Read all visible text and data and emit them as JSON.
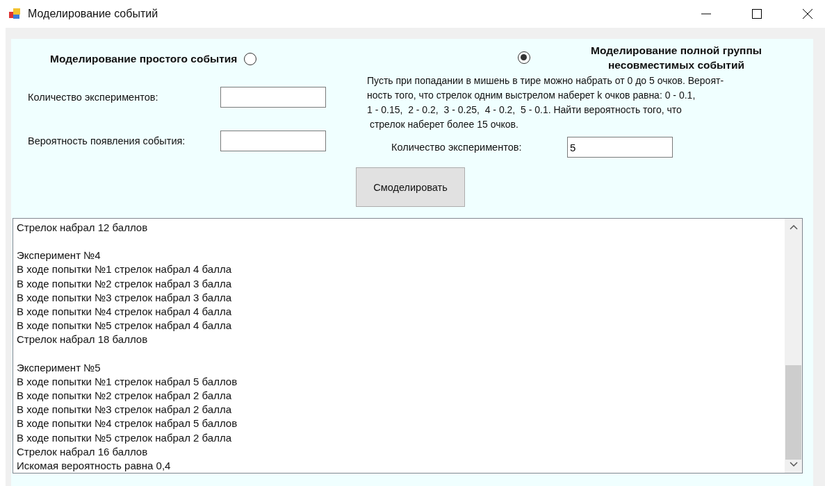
{
  "window": {
    "title": "Моделирование событий"
  },
  "modes": [
    {
      "label": "Моделирование простого события",
      "selected": false
    },
    {
      "label": "Моделирование полной группы несовместимых событий",
      "selected": true
    }
  ],
  "simple": {
    "fields": [
      {
        "label": "Количество экспериментов:"
      },
      {
        "label": "Вероятность появления события:"
      }
    ]
  },
  "group": {
    "problem": "Пусть при попадании в мишень в тире можно набрать от 0 до 5 очков. Вероят-\nность того, что стрелок одним выстрелом наберет k очков равна: 0 - 0.1,\n1 - 0.15,  2 - 0.2,  3 - 0.25,  4 - 0.2,  5 - 0.1. Найти вероятность того, что\n стрелок наберет более 15 очков.",
    "field": {
      "label": "Количество экспериментов:",
      "value": "5"
    }
  },
  "button": "Смоделировать",
  "log": [
    [
      "Стрелок набрал 12 баллов"
    ],
    [
      "Эксперимент №4",
      "В ходе попытки №1 стрелок набрал 4 балла",
      "В ходе попытки №2 стрелок набрал 3 балла",
      "В ходе попытки №3 стрелок набрал 3 балла",
      "В ходе попытки №4 стрелок набрал 4 балла",
      "В ходе попытки №5 стрелок набрал 4 балла",
      "Стрелок набрал 18 баллов"
    ],
    [
      "Эксперимент №5",
      "В ходе попытки №1 стрелок набрал 5 баллов",
      "В ходе попытки №2 стрелок набрал 2 балла",
      "В ходе попытки №3 стрелок набрал 2 балла",
      "В ходе попытки №4 стрелок набрал 5 баллов",
      "В ходе попытки №5 стрелок набрал 2 балла",
      "Стрелок набрал 16 баллов",
      "Искомая вероятность равна 0,4"
    ]
  ]
}
